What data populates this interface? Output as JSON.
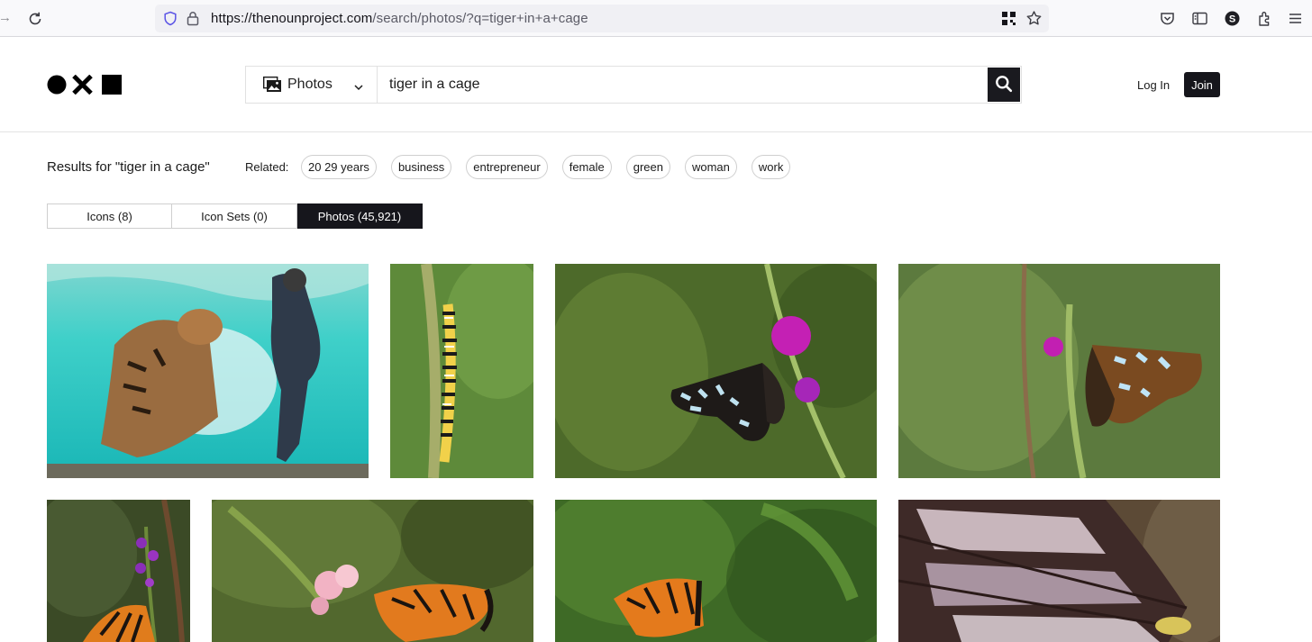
{
  "browser": {
    "url_host": "https://thenounproject.com",
    "url_path": "/search/photos/?q=tiger+in+a+cage"
  },
  "header": {
    "search_type": "Photos",
    "search_query": "tiger in a cage",
    "login_label": "Log In",
    "join_label": "Join"
  },
  "results": {
    "title": "Results for \"tiger in a cage\"",
    "related_label": "Related:",
    "related_tags": [
      "20 29 years",
      "business",
      "entrepreneur",
      "female",
      "green",
      "woman",
      "work"
    ]
  },
  "tabs": [
    {
      "label": "Icons (8)",
      "active": false
    },
    {
      "label": "Icon Sets (0)",
      "active": false
    },
    {
      "label": "Photos (45,921)",
      "active": true
    }
  ],
  "colors": {
    "accent_dark": "#16161c",
    "border": "#cfcfcf"
  }
}
